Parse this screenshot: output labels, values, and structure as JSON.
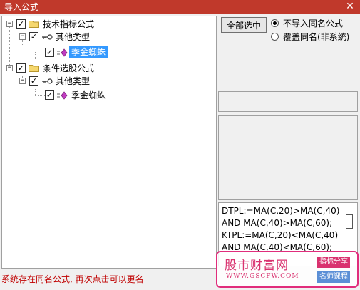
{
  "window": {
    "title": "导入公式",
    "close_glyph": "✕"
  },
  "tree": {
    "nodes": [
      {
        "label": "技术指标公式",
        "checked": true,
        "expander": "−"
      },
      {
        "label": "其他类型",
        "checked": true,
        "expander": "−"
      },
      {
        "label": "季金蜘蛛",
        "checked": true,
        "selected": true
      },
      {
        "label": "条件选股公式",
        "checked": true,
        "expander": "−"
      },
      {
        "label": "其他类型",
        "checked": true,
        "expander": "−"
      },
      {
        "label": "季金蜘蛛",
        "checked": true
      }
    ],
    "check_glyph": "✓"
  },
  "options": {
    "select_all_label": "全部选中",
    "radio_skip_label": "不导入同名公式",
    "radio_overwrite_label": "覆盖同名(非系统)",
    "selected": "skip"
  },
  "formula": {
    "lines": [
      "DTPL:=MA(C,20)>MA(C,40)",
      "AND MA(C,40)>MA(C,60);",
      "KTPL:=MA(C,20)<MA(C,40)",
      "AND MA(C,40)<MA(C,60);"
    ]
  },
  "watermark": {
    "brand": "股市财富网",
    "url": "WWW.GSCFW.COM",
    "tag1": "指标分享",
    "tag2": "名师课程"
  },
  "status": {
    "message": "系统存在同名公式, 再次点击可以更名"
  },
  "colors": {
    "titlebar": "#c0392b",
    "selection": "#3399ff",
    "status_text": "#c00000",
    "watermark": "#d9326f"
  }
}
